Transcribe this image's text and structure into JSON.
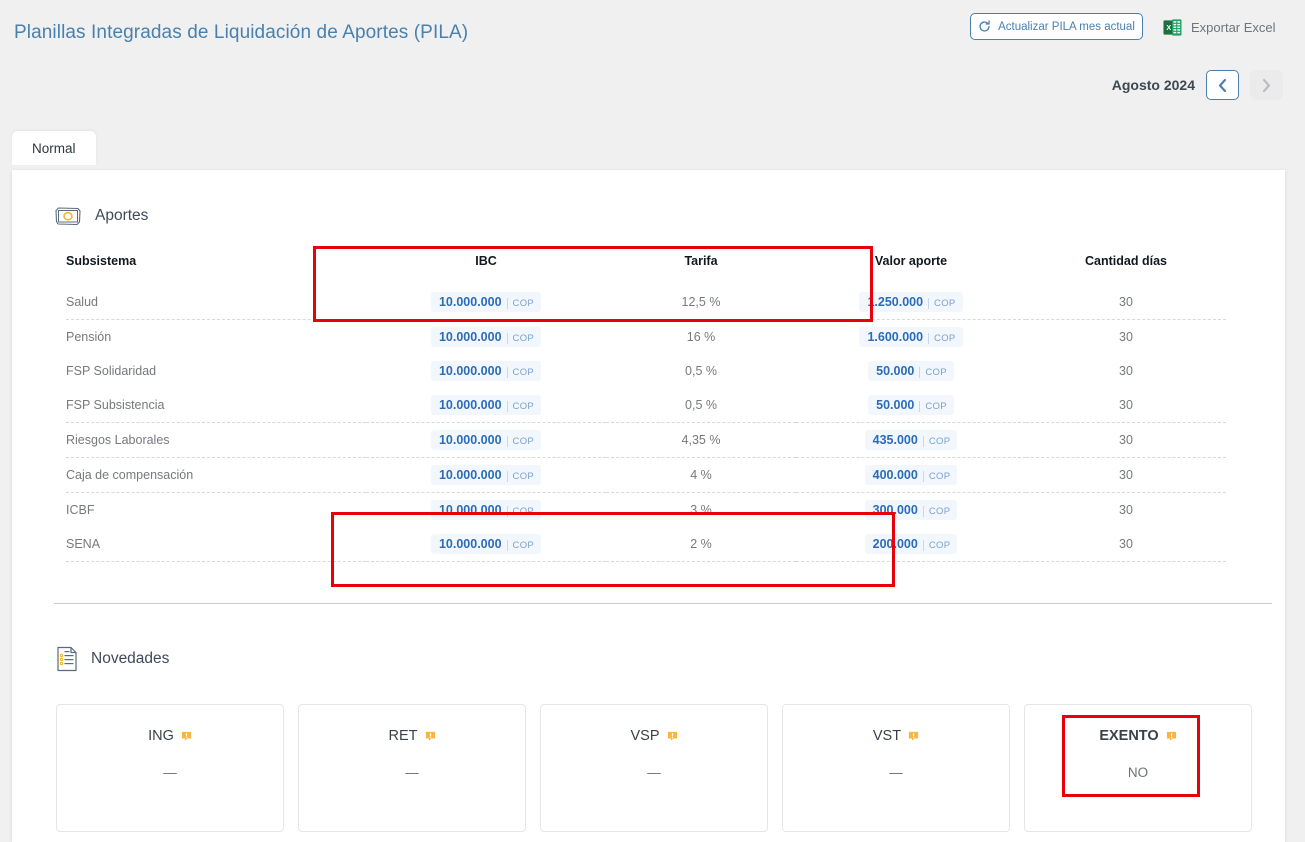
{
  "header": {
    "title": "Planillas Integradas de Liquidación de Aportes (PILA)",
    "refresh_button": "Actualizar PILA mes actual",
    "refresh_icon": "refresh-icon",
    "export_button": "Exportar Excel",
    "export_icon": "excel-icon",
    "month_label": "Agosto 2024",
    "prev_icon": "chevron-left-icon",
    "next_icon": "chevron-right-icon"
  },
  "tabs": [
    {
      "label": "Normal",
      "active": true
    }
  ],
  "aportes": {
    "section_title": "Aportes",
    "section_icon": "money-icon",
    "columns": [
      "Subsistema",
      "IBC",
      "Tarifa",
      "Valor aporte",
      "Cantidad días"
    ],
    "currency": "COP",
    "rows": [
      {
        "subsistema": "Salud",
        "ibc": "10.000.000",
        "tarifa": "12,5 %",
        "valor": "1.250.000",
        "dias": "30"
      },
      {
        "subsistema": "Pensión",
        "ibc": "10.000.000",
        "tarifa": "16 %",
        "valor": "1.600.000",
        "dias": "30"
      },
      {
        "subsistema": "FSP Solidaridad",
        "ibc": "10.000.000",
        "tarifa": "0,5 %",
        "valor": "50.000",
        "dias": "30"
      },
      {
        "subsistema": "FSP Subsistencia",
        "ibc": "10.000.000",
        "tarifa": "0,5 %",
        "valor": "50.000",
        "dias": "30"
      },
      {
        "subsistema": "Riesgos Laborales",
        "ibc": "10.000.000",
        "tarifa": "4,35 %",
        "valor": "435.000",
        "dias": "30"
      },
      {
        "subsistema": "Caja de compensación",
        "ibc": "10.000.000",
        "tarifa": "4 %",
        "valor": "400.000",
        "dias": "30"
      },
      {
        "subsistema": "ICBF",
        "ibc": "10.000.000",
        "tarifa": "3 %",
        "valor": "300.000",
        "dias": "30"
      },
      {
        "subsistema": "SENA",
        "ibc": "10.000.000",
        "tarifa": "2 %",
        "valor": "200.000",
        "dias": "30"
      }
    ]
  },
  "novedades": {
    "section_title": "Novedades",
    "section_icon": "checklist-icon",
    "cards": [
      {
        "label": "ING",
        "value": "—",
        "info_icon": "tooltip-icon",
        "emphasized": false
      },
      {
        "label": "RET",
        "value": "—",
        "info_icon": "tooltip-icon",
        "emphasized": false
      },
      {
        "label": "VSP",
        "value": "—",
        "info_icon": "tooltip-icon",
        "emphasized": false
      },
      {
        "label": "VST",
        "value": "—",
        "info_icon": "tooltip-icon",
        "emphasized": false
      },
      {
        "label": "EXENTO",
        "value": "NO",
        "info_icon": "tooltip-icon",
        "emphasized": true
      }
    ]
  },
  "colors": {
    "brand_blue": "#4a80ad",
    "money_text": "#2b6cb8",
    "money_bg": "#f2f7fd",
    "annotation_red": "#e8000b",
    "page_bg": "#f0f0f0",
    "excel_green": "#1d6f42",
    "tooltip_amber": "#f5b642"
  }
}
